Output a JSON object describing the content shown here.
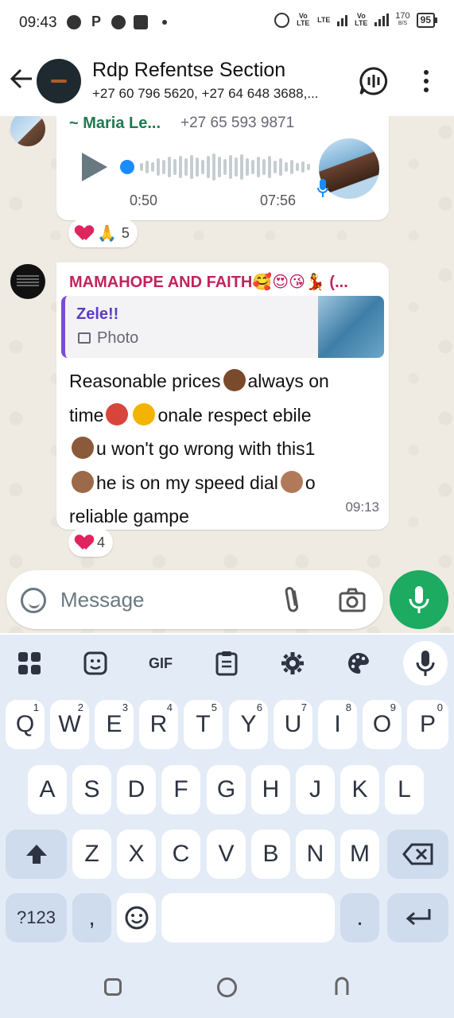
{
  "status_bar": {
    "time": "09:43",
    "speed_value": "170",
    "speed_unit": "B/S",
    "battery": "95",
    "network_1": "Vo LTE",
    "network_2": "LTE",
    "network_3": "Vo LTE"
  },
  "header": {
    "title": "Rdp Refentse Section",
    "subtitle": "+27 60 796 5620, +27 64 648 3688,..."
  },
  "messages": [
    {
      "sender": "~ Maria Le...",
      "phone": "+27 65 593 9871",
      "type": "voice",
      "position": "0:50",
      "duration": "07:56",
      "reaction_count": "5"
    },
    {
      "sender": "MAMAHOPE AND FAITH🥰😍😘💃 (...",
      "quoted_author": "Zele!!",
      "quoted_type": "Photo",
      "text_line_1": "Reasonable prices",
      "text_line_1b": "always on",
      "text_line_2": "time",
      "text_line_2b": "onale respect ebile",
      "text_line_3": "u won't go wrong with this1",
      "text_line_4": "he is on my speed dial",
      "text_line_4b": "o",
      "text_line_5": "reliable gampe",
      "time": "09:13",
      "reaction_count": "4"
    }
  ],
  "composer": {
    "placeholder": "Message"
  },
  "keyboard": {
    "gif_label": "GIF",
    "row1": [
      {
        "key": "Q",
        "num": "1"
      },
      {
        "key": "W",
        "num": "2"
      },
      {
        "key": "E",
        "num": "3"
      },
      {
        "key": "R",
        "num": "4"
      },
      {
        "key": "T",
        "num": "5"
      },
      {
        "key": "Y",
        "num": "6"
      },
      {
        "key": "U",
        "num": "7"
      },
      {
        "key": "I",
        "num": "8"
      },
      {
        "key": "O",
        "num": "9"
      },
      {
        "key": "P",
        "num": "0"
      }
    ],
    "row2": [
      "A",
      "S",
      "D",
      "F",
      "G",
      "H",
      "J",
      "K",
      "L"
    ],
    "row3": [
      "Z",
      "X",
      "C",
      "V",
      "B",
      "N",
      "M"
    ],
    "symbols_label": "?123",
    "comma": ",",
    "period": "."
  }
}
